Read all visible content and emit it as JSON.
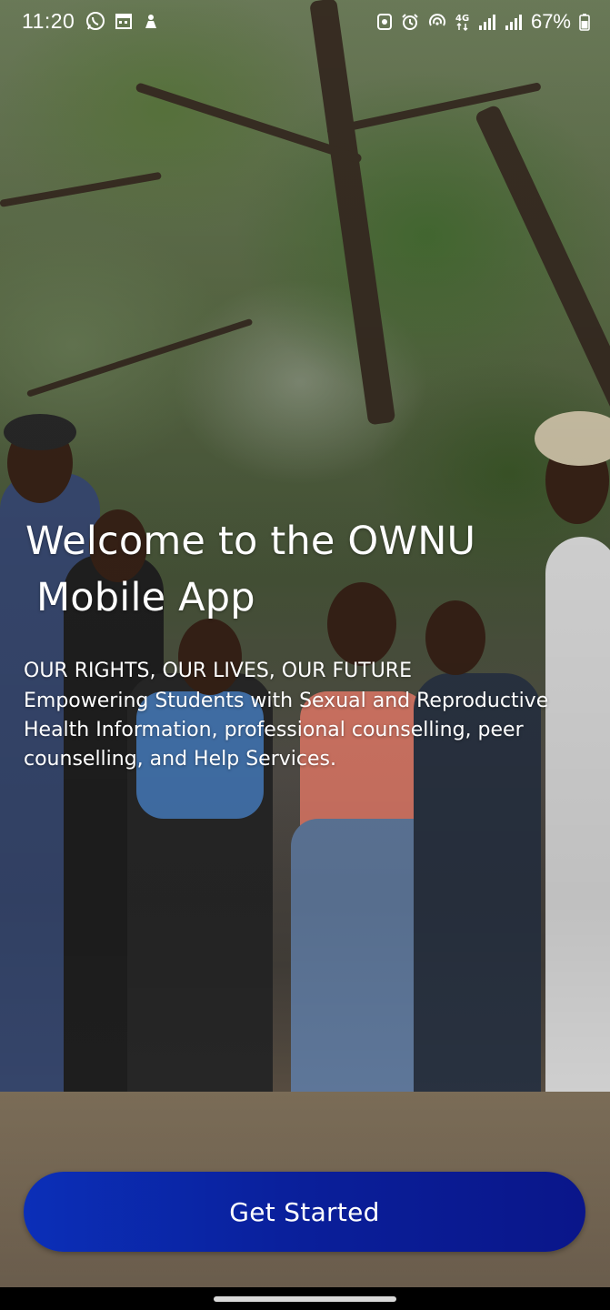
{
  "status_bar": {
    "time": "11:20",
    "battery_percent": "67%",
    "network": "4G",
    "left_icons": [
      "whatsapp-icon",
      "calendar-icon",
      "notification-icon"
    ],
    "right_icons": [
      "nfc-icon",
      "alarm-icon",
      "hotspot-icon",
      "4g-icon",
      "signal-icon",
      "signal-icon",
      "battery-icon"
    ]
  },
  "welcome": {
    "title_line1": "Welcome to the OWNU",
    "title_line2": "Mobile App",
    "tagline": "OUR RIGHTS, OUR LIVES, OUR FUTURE",
    "description": "Empowering Students with Sexual and Reproductive Health Information, professional counselling, peer counselling, and Help Services."
  },
  "cta": {
    "label": "Get Started",
    "color": "#0a1f9a"
  },
  "background": {
    "description_icon": "photo-students-under-trees"
  }
}
